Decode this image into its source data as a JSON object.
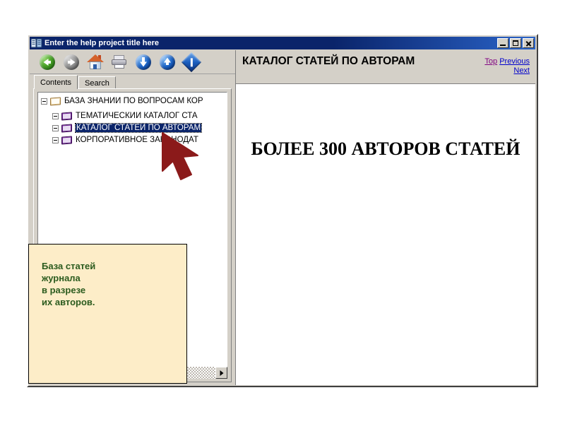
{
  "window": {
    "title": "Enter the help project title here",
    "app_icon": "help-book-icon",
    "buttons": {
      "minimize": "_",
      "maximize": "□",
      "close": "✕"
    }
  },
  "toolbar": {
    "items": [
      {
        "name": "back-button",
        "icon": "back-arrow-icon",
        "tooltip": "Back"
      },
      {
        "name": "forward-button",
        "icon": "forward-arrow-icon",
        "tooltip": "Forward"
      },
      {
        "name": "home-button",
        "icon": "home-icon",
        "tooltip": "Home"
      },
      {
        "name": "print-button",
        "icon": "printer-icon",
        "tooltip": "Print"
      },
      {
        "name": "next-button",
        "icon": "down-arrow-icon",
        "tooltip": "Next"
      },
      {
        "name": "prev-button",
        "icon": "up-arrow-icon",
        "tooltip": "Previous"
      },
      {
        "name": "options-button",
        "icon": "diamond-info-icon",
        "tooltip": "Options"
      }
    ]
  },
  "tabs": {
    "active": "Contents",
    "items": [
      {
        "label": "Contents"
      },
      {
        "label": "Search"
      }
    ]
  },
  "tree": {
    "nodes": [
      {
        "label": "БАЗА ЗНАНИЙ ПО ВОПРОСАМ КОР",
        "level": 0,
        "icon": "open-book-icon",
        "expander": "minus",
        "selected": false
      },
      {
        "label": "ТЕМАТИЧЕСКИЙ КАТАЛОГ СТА",
        "level": 1,
        "icon": "book-icon",
        "expander": "minus",
        "selected": false
      },
      {
        "label": "КАТАЛОГ СТАТЕЙ ПО АВТОРАМ",
        "level": 1,
        "icon": "book-icon",
        "expander": "minus",
        "selected": true
      },
      {
        "label": "КОРПОРАТИВНОЕ ЗАКОНОДАТ",
        "level": 1,
        "icon": "book-icon",
        "expander": "minus",
        "selected": false
      }
    ],
    "scrollbar": {
      "right_arrow": "▶"
    }
  },
  "note": {
    "text": "База статей\nжурнала\nв разрезе\nих авторов.",
    "text_color": "#2b5b1e",
    "background": "#fdedc8"
  },
  "topic": {
    "title": "КАТАЛОГ СТАТЕЙ ПО АВТОРАМ",
    "nav": {
      "top": "Top",
      "previous": "Previous",
      "next": "Next",
      "visited_color": "#800080",
      "link_color": "#0000cc"
    },
    "heading": "БОЛЕЕ 300 АВТОРОВ СТАТЕЙ"
  },
  "cursor": {
    "icon": "arrow-cursor-icon",
    "color": "#8b1a1a"
  }
}
